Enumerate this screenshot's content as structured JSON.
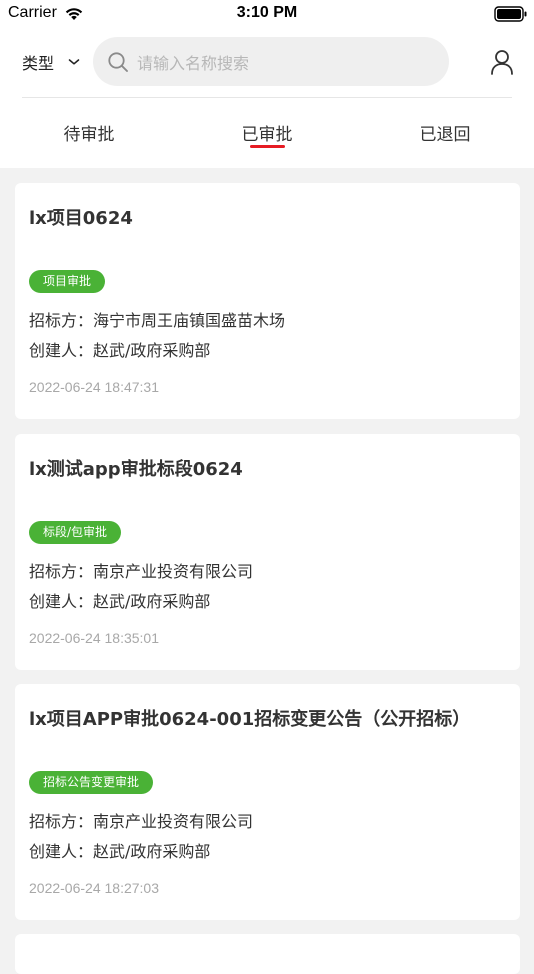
{
  "status_bar": {
    "carrier": "Carrier",
    "time": "3:10 PM",
    "wifi_icon": "wifi-icon",
    "battery_icon": "battery-icon"
  },
  "search": {
    "type_label": "类型",
    "type_chevron_icon": "chevron-down-icon",
    "placeholder": "请输入名称搜索",
    "search_icon": "search-icon",
    "user_icon": "user-icon"
  },
  "tabs": [
    {
      "label": "待审批",
      "active": false
    },
    {
      "label": "已审批",
      "active": true
    },
    {
      "label": "已退回",
      "active": false
    }
  ],
  "colors": {
    "accent_red": "#e61b23",
    "badge_green": "#4ab236",
    "background": "#f2f2f2"
  },
  "cards": [
    {
      "title": "lx项目0624",
      "badge": "项目审批",
      "tenderer_label": "招标方：",
      "tenderer": "海宁市周王庙镇国盛苗木场",
      "creator_label": "创建人：",
      "creator": "赵武/政府采购部",
      "time": "2022-06-24 18:47:31"
    },
    {
      "title": "lx测试app审批标段0624",
      "badge": "标段/包审批",
      "tenderer_label": "招标方：",
      "tenderer": "南京产业投资有限公司",
      "creator_label": "创建人：",
      "creator": "赵武/政府采购部",
      "time": "2022-06-24 18:35:01"
    },
    {
      "title": "lx项目APP审批0624-001招标变更公告（公开招标）",
      "badge": "招标公告变更审批",
      "tenderer_label": "招标方：",
      "tenderer": "南京产业投资有限公司",
      "creator_label": "创建人：",
      "creator": "赵武/政府采购部",
      "time": "2022-06-24 18:27:03"
    }
  ]
}
